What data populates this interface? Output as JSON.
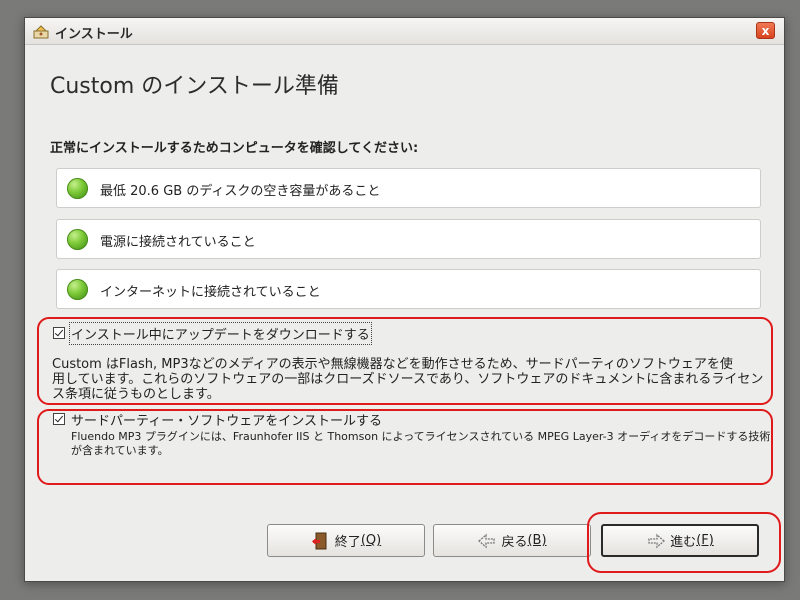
{
  "window": {
    "title": "インストール",
    "close_glyph": "x"
  },
  "heading": "Custom のインストール準備",
  "subheading": "正常にインストールするためコンピュータを確認してください:",
  "requirements": [
    {
      "label": "最低 20.6 GB のディスクの空き容量があること",
      "status": "ok"
    },
    {
      "label": "電源に接続されていること",
      "status": "ok"
    },
    {
      "label": "インターネットに接続されていること",
      "status": "ok"
    }
  ],
  "options": {
    "download_updates": {
      "label": "インストール中にアップデートをダウンロードする",
      "checked": true,
      "description_lines": [
        "Custom はFlash, MP3などのメディアの表示や無線機器などを動作させるため、サードパーティのソフトウェアを使",
        "用しています。これらのソフトウェアの一部はクローズドソースであり、ソフトウェアのドキュメントに含まれるライセン",
        "ス条項に従うものとします。"
      ]
    },
    "third_party": {
      "label": "サードパーティー・ソフトウェアをインストールする",
      "checked": true,
      "description_lines": [
        "Fluendo MP3 プラグインには、Fraunhofer IIS と Thomson によってライセンスされている MPEG Layer-3 オーディオをデコードする技術",
        "が含まれています。"
      ]
    }
  },
  "buttons": {
    "quit": {
      "label": "終了",
      "mnemonic": "(Q)",
      "icon": "exit-door-icon"
    },
    "back": {
      "label": "戻る",
      "mnemonic": "(B)",
      "icon": "back-arrow-icon"
    },
    "forward": {
      "label": "進む",
      "mnemonic": "(F)",
      "icon": "forward-arrow-icon"
    }
  },
  "colors": {
    "status_ok": "#6fbf2e",
    "annotation_red": "#e01a1a",
    "close_button": "#e05a2f"
  }
}
